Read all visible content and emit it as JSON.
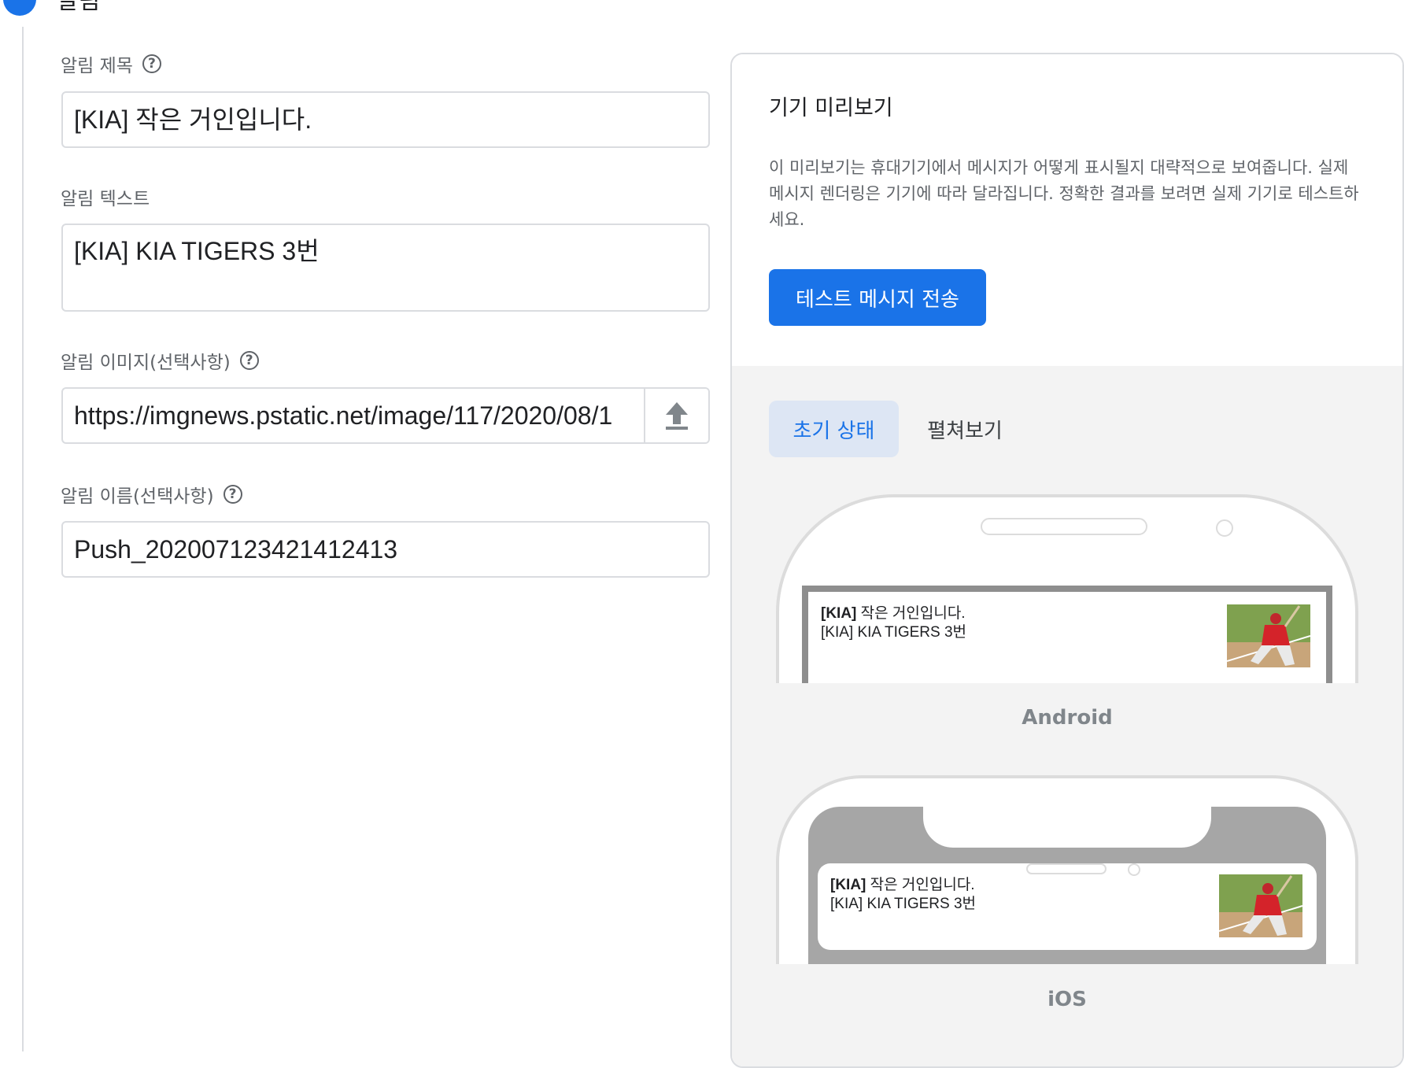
{
  "step": {
    "title": "알림"
  },
  "form": {
    "title_field": {
      "label": "알림 제목",
      "value": "[KIA] 작은 거인입니다."
    },
    "text_field": {
      "label": "알림 텍스트",
      "value": "[KIA] KIA TIGERS 3번"
    },
    "image_field": {
      "label": "알림 이미지(선택사항)",
      "value": "https://imgnews.pstatic.net/image/117/2020/08/1"
    },
    "name_field": {
      "label": "알림 이름(선택사항)",
      "value": "Push_202007123421412413"
    }
  },
  "preview": {
    "title": "기기 미리보기",
    "description": "이 미리보기는 휴대기기에서 메시지가 어떻게 표시될지 대략적으로 보여줍니다. 실제 메시지 렌더링은 기기에 따라 달라집니다. 정확한 결과를 보려면 실제 기기로 테스트하세요.",
    "test_button": "테스트 메시지 전송",
    "tabs": [
      "초기 상태",
      "펼쳐보기"
    ],
    "android": {
      "label": "Android",
      "notif_prefix": "[KIA]",
      "notif_title_rest": " 작은 거인입니다.",
      "notif_text": "[KIA] KIA TIGERS 3번"
    },
    "ios": {
      "label": "iOS",
      "notif_prefix": "[KIA]",
      "notif_title_rest": " 작은 거인입니다.",
      "notif_text": "[KIA] KIA TIGERS 3번"
    }
  },
  "colors": {
    "accent": "#1a73e8",
    "tab_active_bg": "#dde6f4",
    "panel_bg": "#f3f3f3"
  }
}
